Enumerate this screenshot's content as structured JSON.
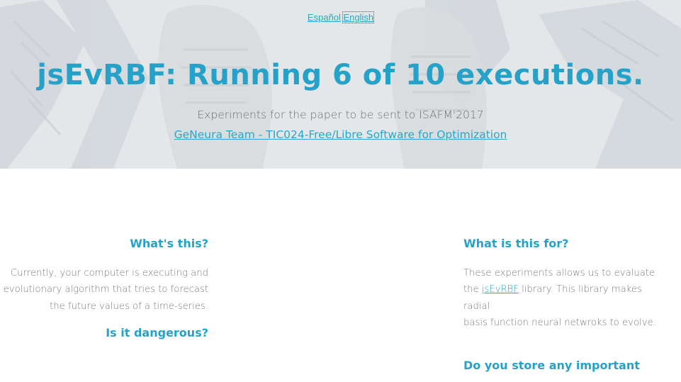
{
  "languages": {
    "es": "Español",
    "en": "English",
    "active": "en"
  },
  "hero": {
    "title": "jsEvRBF: Running 6 of 10 executions.",
    "subtitle": "Experiments for the paper to be sent to ISAFM'2017",
    "team_link": "GeNeura Team - TIC024-Free/Libre Software for Optimization"
  },
  "left_column": {
    "heading_1": "What's this?",
    "text_1": [
      "Currently, your computer is executing and",
      "evolutionary algorithm that tries to forecast",
      "the future values of a time-series."
    ],
    "heading_2": "Is it dangerous?"
  },
  "right_column": {
    "heading_1": "What is this for?",
    "text_1_line1": "These experiments allows us to evaluate",
    "text_1_line2_pre": "the ",
    "text_1_link": "jsEvRBF",
    "text_1_line2_post": " library. This library makes radial",
    "text_1_line3": "basis function neural netwroks to evolve.",
    "heading_2": "Do you store any important"
  },
  "colors": {
    "accent": "#26a2c8",
    "link": "#2aa6c7",
    "body_text": "#7a7a7a",
    "hero_bg": "#e6e8ea"
  }
}
